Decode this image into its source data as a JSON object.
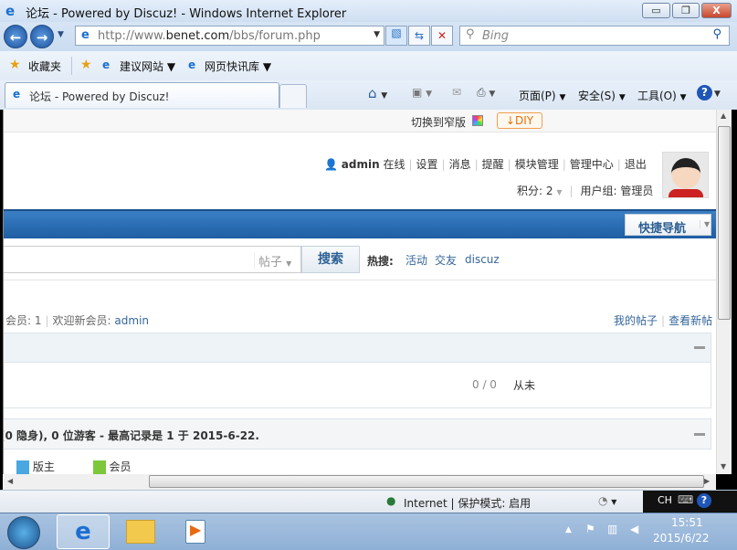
{
  "window": {
    "title": "论坛 - Powered by Discuz! - Windows Internet Explorer",
    "min": "▭",
    "max": "❐",
    "close": "X"
  },
  "address": {
    "url_prefix": "http://www.",
    "url_host": "benet.com",
    "url_path": "/bbs/forum.php",
    "search_placeholder": "Bing"
  },
  "favorites": {
    "label": "收藏夹",
    "items": [
      "建议网站",
      "网页快讯库"
    ]
  },
  "tab": {
    "label": "论坛 - Powered by Discuz!"
  },
  "command_bar": {
    "page": "页面(P)",
    "safety": "安全(S)",
    "tools": "工具(O)"
  },
  "topbar": {
    "switch_narrow": "切换到窄版",
    "diy": "DIY"
  },
  "user": {
    "name": "admin",
    "online": "在线",
    "links": [
      "设置",
      "消息",
      "提醒",
      "模块管理",
      "管理中心",
      "退出"
    ],
    "points": "积分: 2",
    "group": "用户组: 管理员"
  },
  "nav": {
    "quick_nav": "快捷导航"
  },
  "searchbar": {
    "type": "帖子",
    "button": "搜索",
    "hot_label": "热搜:",
    "hot": [
      "活动",
      "交友",
      "discuz"
    ]
  },
  "stats": {
    "members": "会员: 1",
    "welcome_label": "欢迎新会员:",
    "new_member": "admin",
    "my_posts": "我的帖子",
    "view_new": "查看新帖"
  },
  "forum": {
    "counts": "0 / 0",
    "last_post": "从未"
  },
  "online": {
    "summary": "(0 隐身), 0 位游客  - 最高记录是  1 于  2015-6-22.",
    "legend": [
      "版主",
      "会员"
    ]
  },
  "statusbar": {
    "zone": "Internet | 保护模式: 启用"
  },
  "taskbar": {
    "lang": "CH",
    "time": "15:51",
    "date": "2015/6/22"
  }
}
